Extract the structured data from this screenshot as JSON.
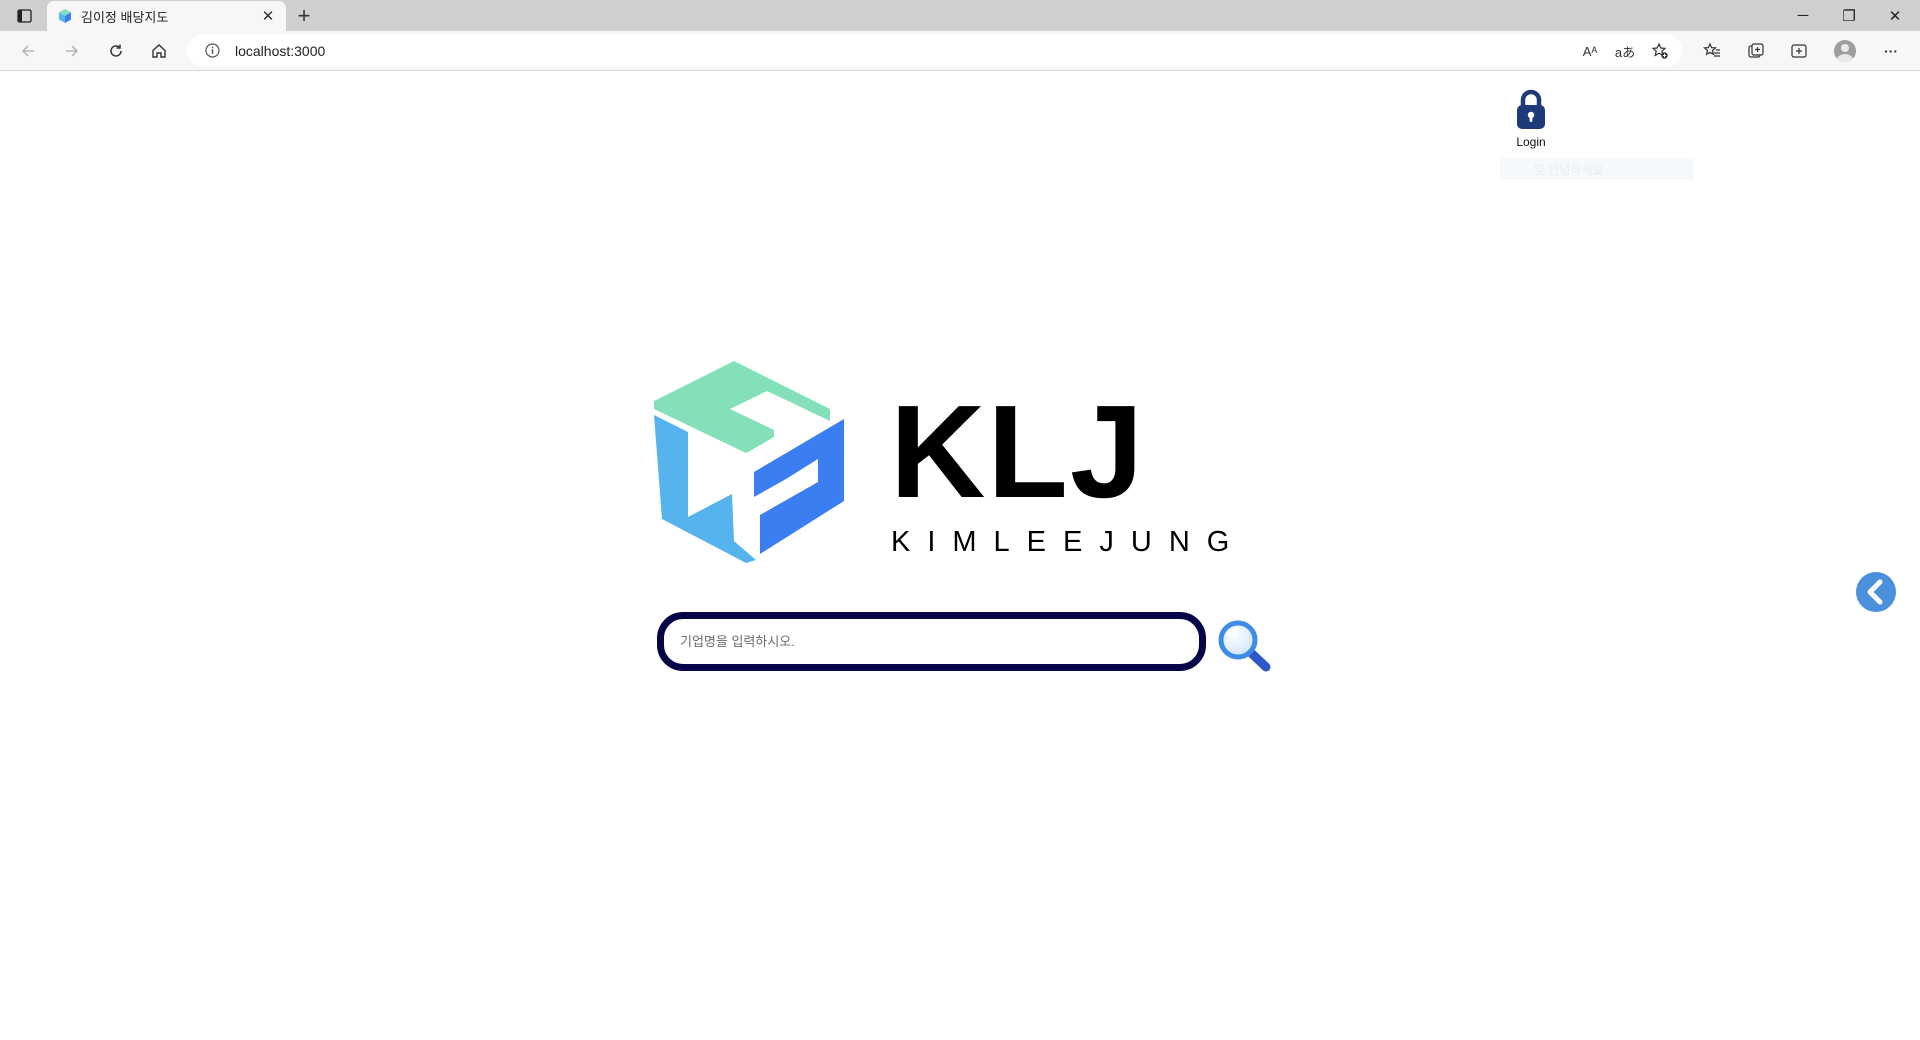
{
  "browser": {
    "tab_title": "김이정 배당지도",
    "close_glyph": "✕",
    "new_tab_glyph": "+",
    "url": "localhost:3000",
    "window_controls": {
      "minimize": "─",
      "restore": "❐",
      "close": "✕"
    },
    "more_glyph": "···",
    "read_aloud": "Aᴬ",
    "translate": "aあ"
  },
  "header": {
    "login_label": "Login",
    "hidden_text": "및 안녕하세요"
  },
  "logo": {
    "wordmark": "KLJ",
    "subtitle": "KIMLEEJUNG",
    "colors": {
      "green": "#83e0b8",
      "light_blue": "#55b4ee",
      "blue": "#3a7ef2",
      "text": "#000000"
    }
  },
  "search": {
    "placeholder": "기업명을 입력하시오.",
    "value": "",
    "border_color": "#050647"
  },
  "icons": {
    "lock": "lock-icon",
    "search": "search-icon",
    "side_toggle": "chevron-left-icon"
  }
}
